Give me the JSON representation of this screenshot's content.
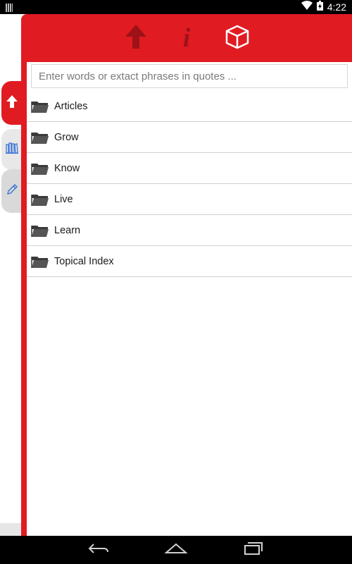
{
  "status_bar": {
    "time": "4:22",
    "icons": [
      "sim-icon",
      "wifi-icon",
      "battery-icon"
    ]
  },
  "side_tabs": [
    {
      "name": "up-arrow-tab",
      "icon": "up-arrow-icon",
      "active": true
    },
    {
      "name": "books-tab",
      "icon": "books-icon",
      "active": false
    },
    {
      "name": "pencil-tab",
      "icon": "pencil-icon",
      "active": false
    }
  ],
  "toolbar": {
    "icons": [
      "up-arrow-icon",
      "info-icon",
      "cube-icon"
    ],
    "info_glyph": "i"
  },
  "search": {
    "placeholder": "Enter words or extact phrases in quotes ...",
    "value": ""
  },
  "list": {
    "items": [
      {
        "label": "Articles",
        "icon": "folder-icon"
      },
      {
        "label": "Grow",
        "icon": "folder-icon"
      },
      {
        "label": "Know",
        "icon": "folder-icon"
      },
      {
        "label": "Live",
        "icon": "folder-icon"
      },
      {
        "label": "Learn",
        "icon": "folder-icon"
      },
      {
        "label": "Topical Index",
        "icon": "folder-icon"
      }
    ]
  },
  "nav_bar": {
    "buttons": [
      "back-icon",
      "home-icon",
      "recents-icon"
    ]
  },
  "colors": {
    "accent": "#e11b22",
    "accent_dark": "#9d1217",
    "tab_icon_blue": "#3b73d6"
  }
}
